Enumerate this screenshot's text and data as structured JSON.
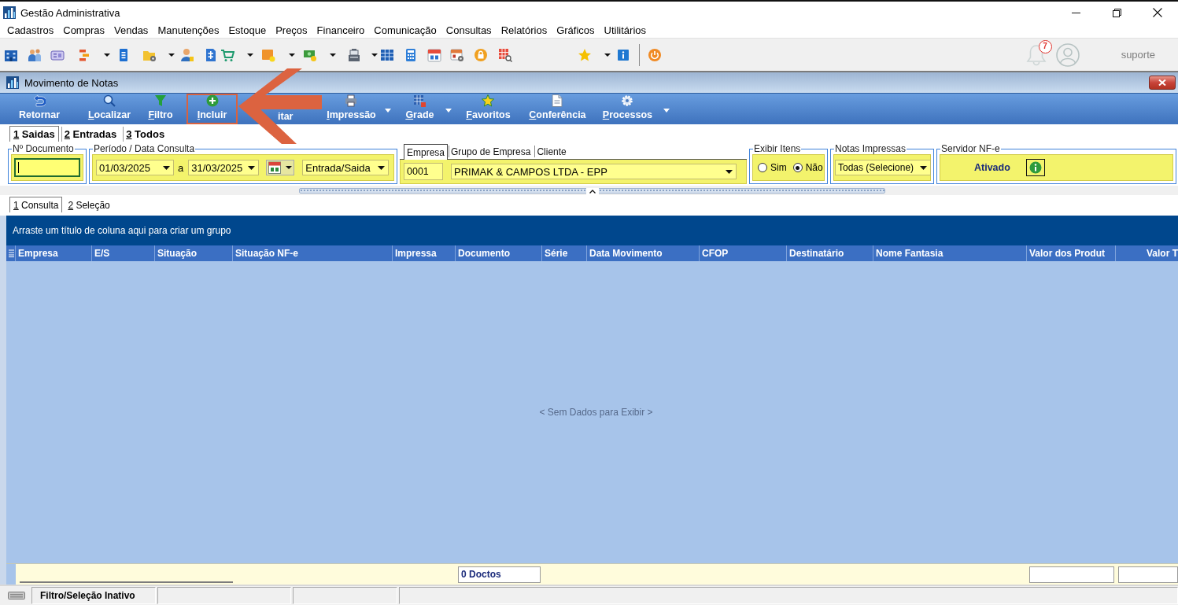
{
  "app_window": {
    "title": "Gestão Administrativa"
  },
  "menu": [
    "Cadastros",
    "Compras",
    "Vendas",
    "Manutenções",
    "Estoque",
    "Preços",
    "Financeiro",
    "Comunicação",
    "Consultas",
    "Relatórios",
    "Gráficos",
    "Utilitários"
  ],
  "notifications": {
    "count": "7"
  },
  "user": {
    "name": "suporte"
  },
  "document_window": {
    "title": "Movimento de Notas"
  },
  "ribbon": [
    {
      "label": "Retornar",
      "mnemonic": false,
      "dropdown": false,
      "highlighted": false
    },
    {
      "label": "Localizar",
      "mnemonic": true,
      "dropdown": false,
      "highlighted": false
    },
    {
      "label": "Filtro",
      "mnemonic": true,
      "dropdown": false,
      "highlighted": false
    },
    {
      "label": "Incluir",
      "mnemonic": true,
      "dropdown": false,
      "highlighted": true
    },
    {
      "label": "itar",
      "mnemonic": false,
      "dropdown": false,
      "highlighted": false
    },
    {
      "label": "Impressão",
      "mnemonic": true,
      "dropdown": true,
      "highlighted": false
    },
    {
      "label": "Grade",
      "mnemonic": true,
      "dropdown": true,
      "highlighted": false
    },
    {
      "label": "Favoritos",
      "mnemonic": true,
      "dropdown": false,
      "highlighted": false
    },
    {
      "label": "Conferência",
      "mnemonic": true,
      "dropdown": false,
      "highlighted": false
    },
    {
      "label": "Processos",
      "mnemonic": true,
      "dropdown": true,
      "highlighted": false
    }
  ],
  "callout": {
    "kind": "arrow"
  },
  "query_tabs": [
    {
      "label": "1 Saidas",
      "mnemonic": true,
      "selected": true
    },
    {
      "label": "2 Entradas",
      "mnemonic": true,
      "selected": false
    },
    {
      "label": "3 Todos",
      "mnemonic": true,
      "selected": false
    }
  ],
  "document_number": {
    "legend": "Nº Documento",
    "focused": true
  },
  "period": {
    "legend": "Período / Data Consulta",
    "from": "01/03/2025",
    "separator": "a",
    "to": "31/03/2025",
    "direction": "Entrada/Saida"
  },
  "company": {
    "tabs": [
      {
        "label": "Empresa",
        "selected": true
      },
      {
        "label": "Grupo de Empresa",
        "selected": false
      },
      {
        "label": "Cliente",
        "selected": false
      }
    ],
    "code": "0001",
    "name": "PRIMAK & CAMPOS LTDA - EPP"
  },
  "show_items": {
    "legend": "Exibir Itens",
    "options": [
      {
        "label": "Sim",
        "selected": false
      },
      {
        "label": "Não",
        "selected": true
      }
    ]
  },
  "printed_notes": {
    "legend": "Notas Impressas",
    "value": "Todas (Selecione)"
  },
  "nfe_server": {
    "legend": "Servidor NF-e",
    "status": "Ativado"
  },
  "result_tabs": [
    {
      "label": "1 Consulta",
      "mnemonic": true,
      "selected": true
    },
    {
      "label": "2 Seleção",
      "mnemonic": true,
      "selected": false
    }
  ],
  "grid": {
    "group_hint": "Arraste um título de coluna aqui para criar um grupo",
    "columns": [
      "Empresa",
      "E/S",
      "Situação",
      "Situação NF-e",
      "Impressa",
      "Documento",
      "Série",
      "Data Movimento",
      "CFOP",
      "Destinatário",
      "Nome Fantasia",
      "Valor dos Produt",
      "Valor T"
    ],
    "empty_text": "< Sem Dados para Exibir >",
    "count": "0 Doctos"
  },
  "status_bar": {
    "panels": [
      "Filtro/Seleção Inativo"
    ]
  }
}
